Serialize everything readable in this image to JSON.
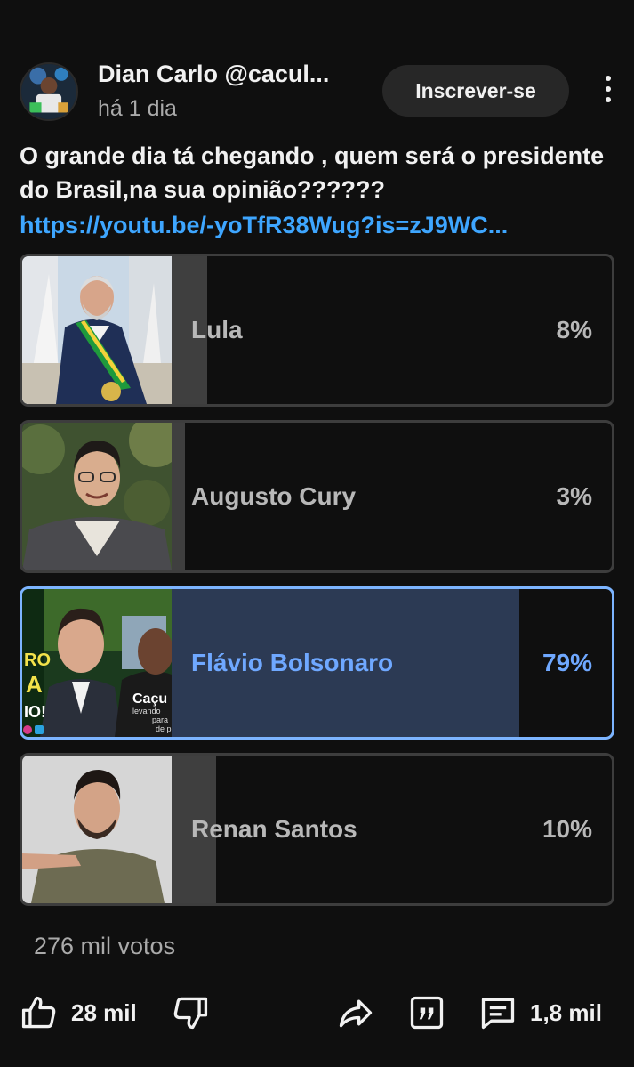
{
  "post": {
    "author": "Dian Carlo @cacul...",
    "time": "há 1 dia",
    "subscribe_label": "Inscrever-se",
    "text": "O grande dia tá chegando , quem será o presidente do Brasil,na sua opinião??????",
    "link": "https://youtu.be/-yoTfR38Wug?is=zJ9WC..."
  },
  "poll": {
    "options": [
      {
        "name": "Lula",
        "percent_label": "8%",
        "percent": 8,
        "selected": false
      },
      {
        "name": "Augusto Cury",
        "percent_label": "3%",
        "percent": 3,
        "selected": false
      },
      {
        "name": "Flávio Bolsonaro",
        "percent_label": "79%",
        "percent": 79,
        "selected": true
      },
      {
        "name": "Renan Santos",
        "percent_label": "10%",
        "percent": 10,
        "selected": false
      }
    ],
    "votes_label": "276 mil votos"
  },
  "thumbnail_text": {
    "flavio_left": [
      "RO",
      "A",
      "IO!"
    ],
    "flavio_right": [
      "Caçu",
      "levando",
      "para",
      "de p"
    ]
  },
  "actions": {
    "like_count": "28 mil",
    "comment_count": "1,8 mil"
  },
  "colors": {
    "background": "#0f0f0f",
    "link": "#3ea6ff",
    "selected_border": "#7cb4ff",
    "selected_text": "#6fa8ff",
    "selected_fill": "#2c3a54",
    "unselected_fill": "#3f3f3f"
  }
}
